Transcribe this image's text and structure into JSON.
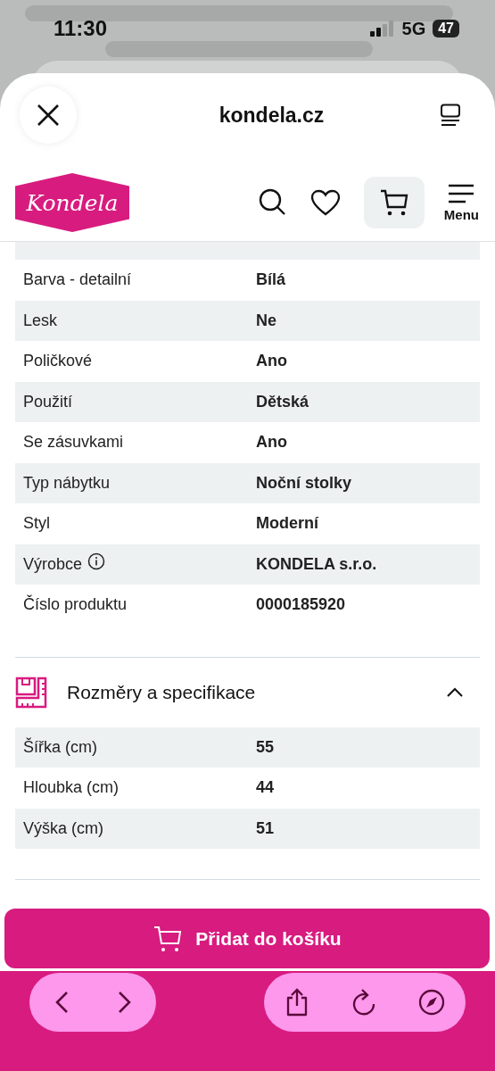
{
  "status_bar": {
    "time": "11:30",
    "network": "5G",
    "battery": "47"
  },
  "browser": {
    "title": "kondela.cz"
  },
  "site_header": {
    "logo": "Kondela",
    "menu_label": "Menu"
  },
  "parameters": [
    {
      "name": "Barva - detailní",
      "value": "Bílá"
    },
    {
      "name": "Lesk",
      "value": "Ne"
    },
    {
      "name": "Poličkové",
      "value": "Ano"
    },
    {
      "name": "Použití",
      "value": "Dětská"
    },
    {
      "name": "Se zásuvkami",
      "value": "Ano"
    },
    {
      "name": "Typ nábytku",
      "value": "Noční stolky"
    },
    {
      "name": "Styl",
      "value": "Moderní"
    },
    {
      "name": "Výrobce",
      "value": "KONDELA s.r.o.",
      "info": true
    },
    {
      "name": "Číslo produktu",
      "value": "0000185920"
    }
  ],
  "dimensions": {
    "title": "Rozměry a specifikace",
    "expanded": true,
    "rows": [
      {
        "name": "Šířka (cm)",
        "value": "55"
      },
      {
        "name": "Hloubka (cm)",
        "value": "44"
      },
      {
        "name": "Výška (cm)",
        "value": "51"
      }
    ]
  },
  "add_to_cart": "Přidat do košíku"
}
